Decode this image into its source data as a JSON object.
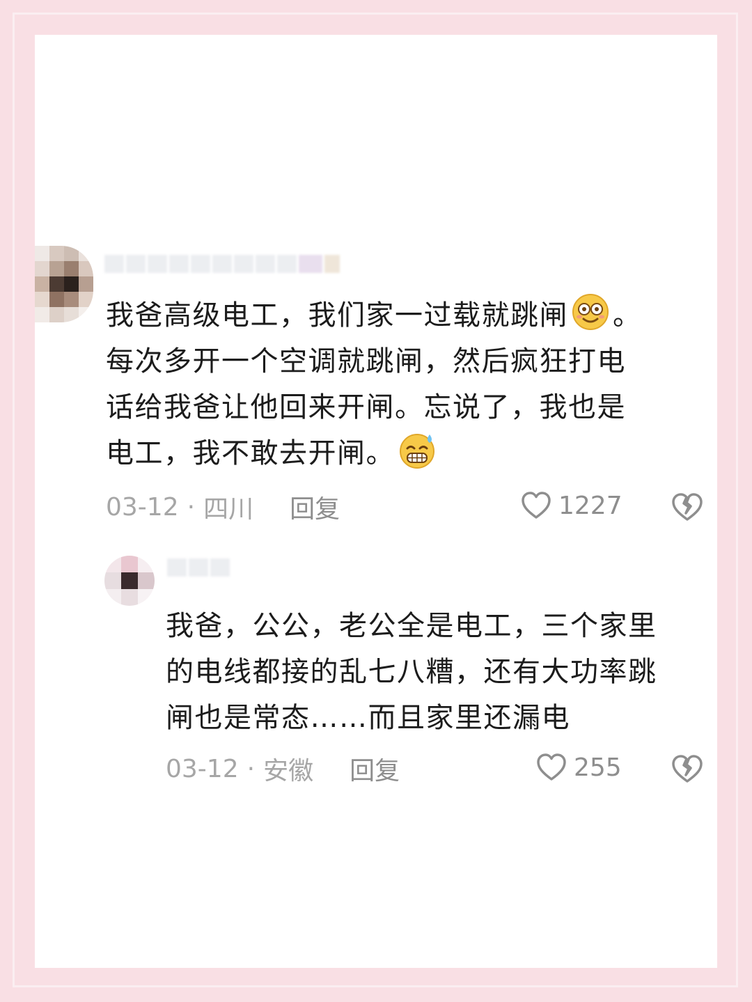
{
  "comment": {
    "text_lines": [
      "我爸高级电工，我们家一过载就跳闸",
      "每次多开一个空调就跳闸，然后疯狂打电",
      "话给我爸让他回来开闸。忘说了，我也是",
      "电工，我不敢去开闸。"
    ],
    "line1_end": "。",
    "date": "03-12",
    "separator": "·",
    "location": "四川",
    "reply_label": "回复",
    "likes": "1227",
    "emojis": [
      "dazed-face-icon",
      "grin-sweat-icon"
    ]
  },
  "reply": {
    "text_lines": [
      "我爸，公公，老公全是电工，三个家里",
      "的电线都接的乱七八糟，还有大功率跳",
      "闸也是常态……而且家里还漏电"
    ],
    "date": "03-12",
    "separator": "·",
    "location": "安徽",
    "reply_label": "回复",
    "likes": "255"
  },
  "colors": {
    "frame": "#f9dfe4",
    "text": "#1c1c1c",
    "meta": "#a6a6a6"
  },
  "icons": [
    "heart-outline-icon",
    "broken-heart-icon"
  ]
}
